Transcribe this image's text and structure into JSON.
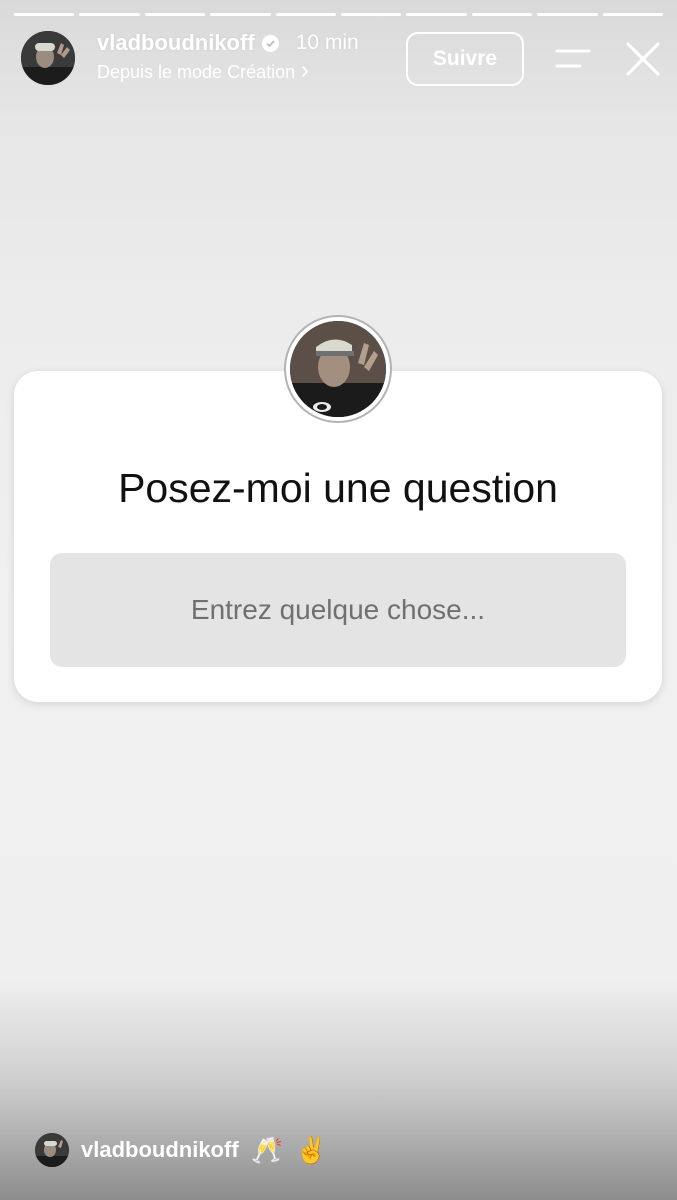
{
  "story": {
    "progress_total": 10,
    "progress_current": 10
  },
  "header": {
    "username": "vladboudnikoff",
    "time": "10 min",
    "subtitle": "Depuis le mode Création",
    "follow_label": "Suivre",
    "icons": {
      "menu": "menu-lines-icon",
      "close": "close-icon",
      "verified": "verified-badge-icon"
    }
  },
  "question_card": {
    "title": "Posez-moi une question",
    "input_placeholder": "Entrez quelque chose..."
  },
  "footer": {
    "username": "vladboudnikoff",
    "emojis": [
      "🥂",
      "✌️"
    ]
  },
  "colors": {
    "card_background": "#ffffff",
    "input_background": "#e4e4e4",
    "text_dark": "#111111",
    "text_on_overlay": "#ffffff"
  }
}
